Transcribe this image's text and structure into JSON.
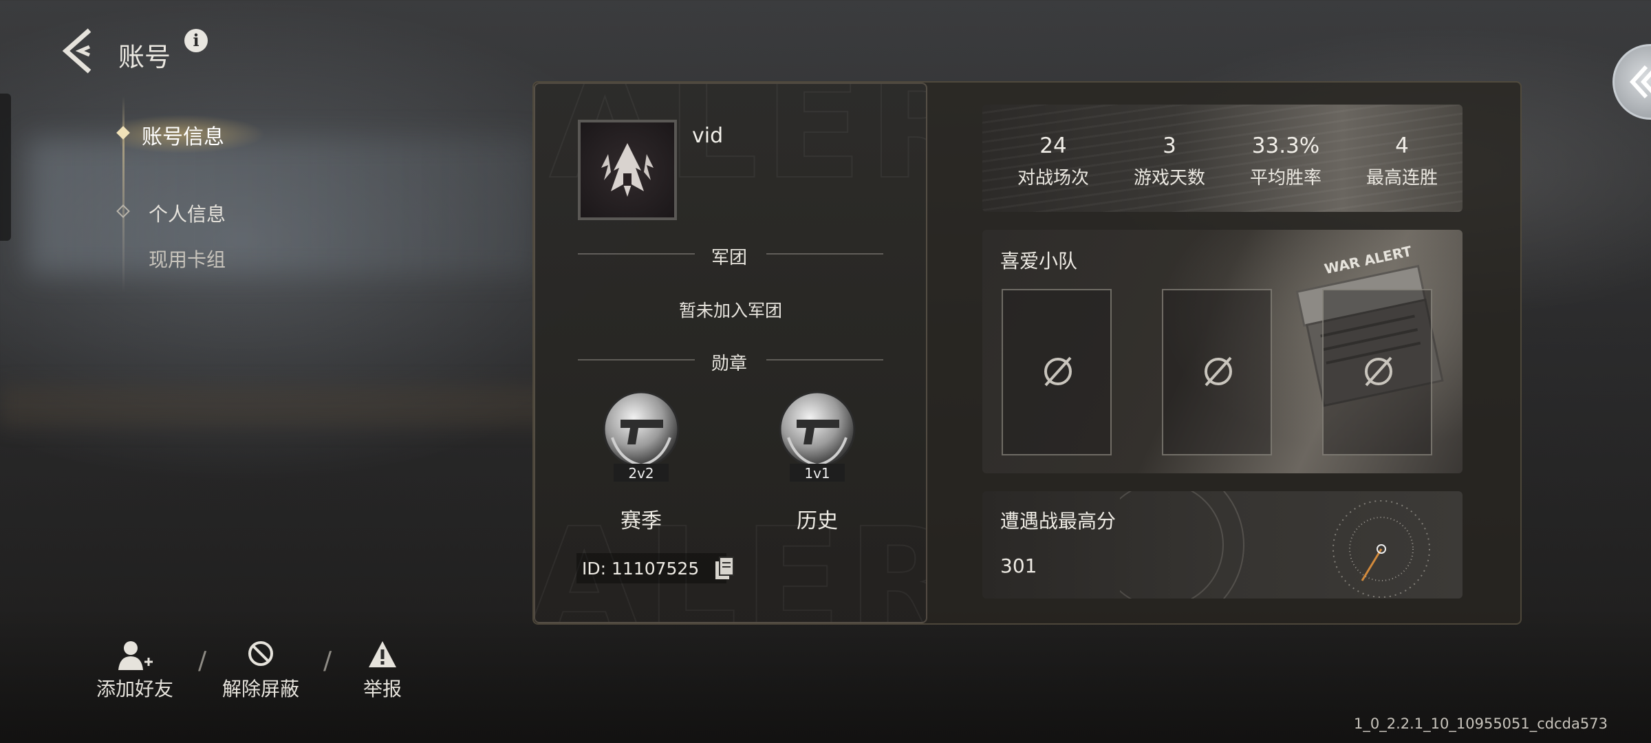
{
  "header": {
    "title": "账号",
    "info_glyph": "i"
  },
  "nav": {
    "items": [
      {
        "label": "账号信息",
        "active": true
      },
      {
        "label": "个人信息",
        "active": false
      },
      {
        "label": "现用卡组",
        "active": false
      }
    ]
  },
  "profile": {
    "name": "vid",
    "corps_title": "军团",
    "corps_status": "暂未加入军团",
    "medals_title": "勋章",
    "medals": [
      {
        "badge": "2v2",
        "caption": "赛季"
      },
      {
        "badge": "1v1",
        "caption": "历史"
      }
    ],
    "id_text": "ID: 11107525"
  },
  "stats": [
    {
      "value": "24",
      "label": "对战场次"
    },
    {
      "value": "3",
      "label": "游戏天数"
    },
    {
      "value": "33.3%",
      "label": "平均胜率"
    },
    {
      "value": "4",
      "label": "最高连胜"
    }
  ],
  "squad": {
    "title": "喜爱小队",
    "slots": [
      "empty-slot-icon",
      "empty-slot-icon",
      "empty-slot-icon"
    ],
    "tag_text": "WAR ALERT"
  },
  "score": {
    "title": "遭遇战最高分",
    "value": "301"
  },
  "footer": {
    "add_friend": "添加好友",
    "unblock": "解除屏蔽",
    "report": "举报",
    "separator": "/"
  },
  "version": "1_0_2.2.1_10_10955051_cdcda573",
  "colors": {
    "accent_gold": "#d8b97a",
    "panel_border": "#6e6450"
  }
}
